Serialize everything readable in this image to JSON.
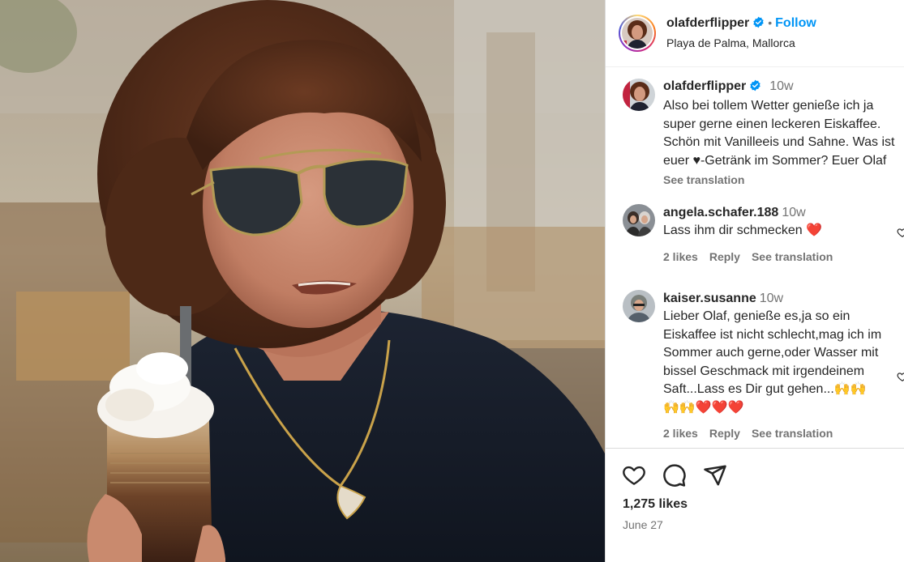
{
  "post": {
    "username": "olafderflipper",
    "follow_label": "Follow",
    "location": "Playa de Palma, Mallorca",
    "dot": "•"
  },
  "caption": {
    "username": "olafderflipper",
    "time": "10w",
    "text": "Also bei tollem Wetter genieße ich ja super gerne einen leckeren Eiskaffee. Schön mit Vanilleeis und Sahne. Was ist euer ♥-Getränk im Sommer? Euer Olaf",
    "see_translation": "See translation"
  },
  "comments": [
    {
      "username": "angela.schafer.188",
      "time": "10w",
      "text": "Lass ihm dir schmecken ❤️",
      "likes": "2 likes",
      "reply": "Reply",
      "see_translation": "See translation"
    },
    {
      "username": "kaiser.susanne",
      "time": "10w",
      "text": "Lieber Olaf, genieße es,ja so ein Eiskaffee ist nicht schlecht,mag ich im Sommer auch gerne,oder Wasser mit bissel Geschmack mit irgendeinem Saft...Lass es Dir gut gehen...🙌🙌🙌🙌❤️❤️❤️",
      "likes": "2 likes",
      "reply": "Reply",
      "see_translation": "See translation"
    }
  ],
  "footer": {
    "likes": "1,275 likes",
    "date": "June 27"
  },
  "icons": {
    "like": "heart-icon",
    "comment": "comment-icon",
    "share": "share-icon",
    "verified": "verified-badge-icon"
  },
  "colors": {
    "accent": "#0095f6",
    "verified": "#0095f6",
    "heart": "#ed1c24",
    "muted": "#737373"
  }
}
